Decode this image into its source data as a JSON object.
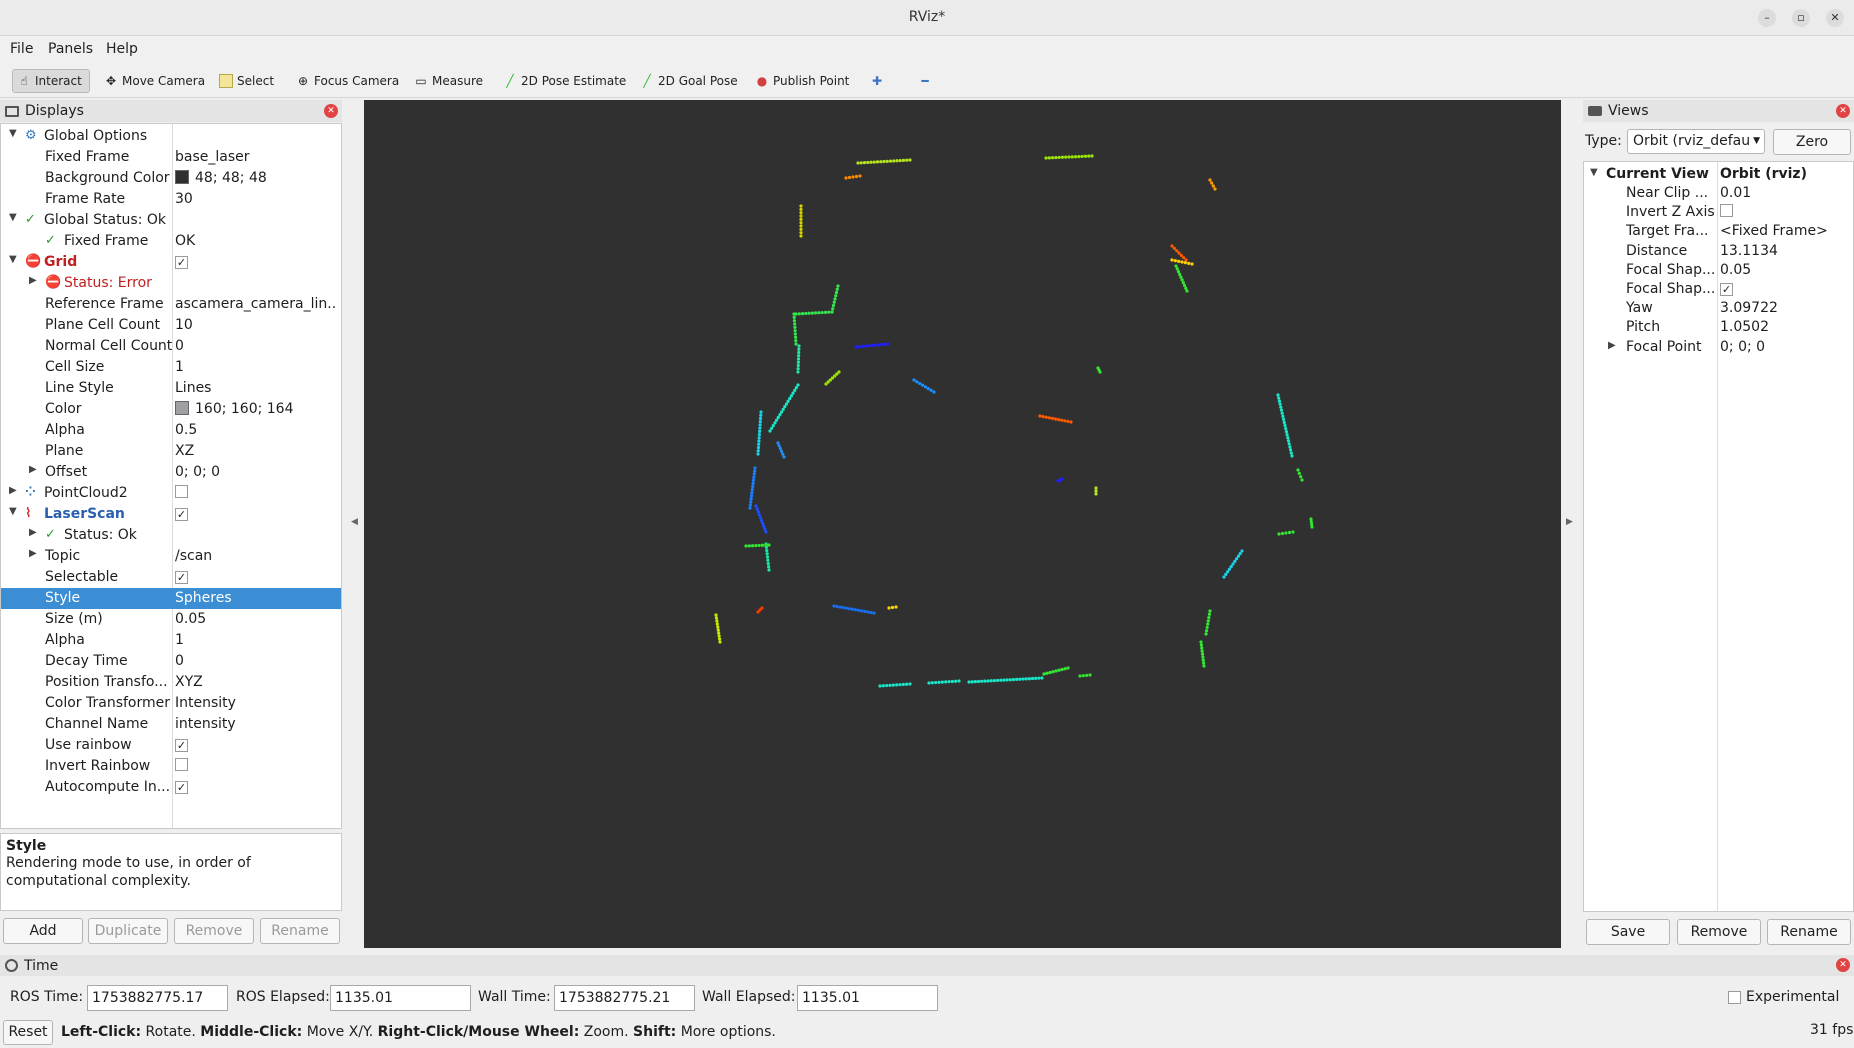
{
  "window": {
    "title": "RViz*"
  },
  "menu": [
    "File",
    "Panels",
    "Help"
  ],
  "toolbar": {
    "tools": [
      {
        "label": "Interact",
        "icon": "cursor-icon",
        "active": true
      },
      {
        "label": "Move Camera",
        "icon": "move-camera-icon"
      },
      {
        "label": "Select",
        "icon": "select-icon"
      },
      {
        "label": "Focus Camera",
        "icon": "focus-camera-icon"
      },
      {
        "label": "Measure",
        "icon": "ruler-icon"
      },
      {
        "label": "2D Pose Estimate",
        "icon": "pose-arrow-icon"
      },
      {
        "label": "2D Goal Pose",
        "icon": "goal-arrow-icon"
      },
      {
        "label": "Publish Point",
        "icon": "map-pin-icon"
      }
    ]
  },
  "displays": {
    "title": "Displays",
    "rows": [
      {
        "label": "Global Options",
        "value": "",
        "indent": 1,
        "expand": "down",
        "icon": "gear"
      },
      {
        "label": "Fixed Frame",
        "value": "base_laser",
        "indent": 2
      },
      {
        "label": "Background Color",
        "value": "48; 48; 48",
        "indent": 2,
        "swatch": "#303030"
      },
      {
        "label": "Frame Rate",
        "value": "30",
        "indent": 2
      },
      {
        "label": "Global Status: Ok",
        "value": "",
        "indent": 1,
        "expand": "down",
        "icon": "check"
      },
      {
        "label": "Fixed Frame",
        "value": "OK",
        "indent": 2,
        "icon": "check"
      },
      {
        "label": "Grid",
        "value": "",
        "indent": 1,
        "expand": "down",
        "icon": "error",
        "checkbox": true,
        "style": "error"
      },
      {
        "label": "Status: Error",
        "value": "",
        "indent": 2,
        "expand": "right",
        "icon": "error",
        "style": "errtext"
      },
      {
        "label": "Reference Frame",
        "value": "ascamera_camera_lin...",
        "indent": 2
      },
      {
        "label": "Plane Cell Count",
        "value": "10",
        "indent": 2
      },
      {
        "label": "Normal Cell Count",
        "value": "0",
        "indent": 2
      },
      {
        "label": "Cell Size",
        "value": "1",
        "indent": 2
      },
      {
        "label": "Line Style",
        "value": "Lines",
        "indent": 2
      },
      {
        "label": "Color",
        "value": "160; 160; 164",
        "indent": 2,
        "swatch": "#a0a0a4"
      },
      {
        "label": "Alpha",
        "value": "0.5",
        "indent": 2
      },
      {
        "label": "Plane",
        "value": "XZ",
        "indent": 2
      },
      {
        "label": "Offset",
        "value": "0; 0; 0",
        "indent": 2,
        "expand": "right"
      },
      {
        "label": "PointCloud2",
        "value": "",
        "indent": 1,
        "expand": "right",
        "icon": "cloud",
        "checkbox": false
      },
      {
        "label": "LaserScan",
        "value": "",
        "indent": 1,
        "expand": "down",
        "icon": "laser",
        "checkbox": true,
        "style": "bluebold"
      },
      {
        "label": "Status: Ok",
        "value": "",
        "indent": 2,
        "expand": "right",
        "icon": "check"
      },
      {
        "label": "Topic",
        "value": "/scan",
        "indent": 2,
        "expand": "right"
      },
      {
        "label": "Selectable",
        "value": "",
        "indent": 2,
        "checkbox": true
      },
      {
        "label": "Style",
        "value": "Spheres",
        "indent": 2,
        "selected": true
      },
      {
        "label": "Size (m)",
        "value": "0.05",
        "indent": 2
      },
      {
        "label": "Alpha",
        "value": "1",
        "indent": 2
      },
      {
        "label": "Decay Time",
        "value": "0",
        "indent": 2
      },
      {
        "label": "Position Transfo...",
        "value": "XYZ",
        "indent": 2
      },
      {
        "label": "Color Transformer",
        "value": "Intensity",
        "indent": 2
      },
      {
        "label": "Channel Name",
        "value": "intensity",
        "indent": 2
      },
      {
        "label": "Use rainbow",
        "value": "",
        "indent": 2,
        "checkbox": true
      },
      {
        "label": "Invert Rainbow",
        "value": "",
        "indent": 2,
        "checkbox": false
      },
      {
        "label": "Autocompute In...",
        "value": "",
        "indent": 2,
        "checkbox": true
      }
    ],
    "help_title": "Style",
    "help_text": "Rendering mode to use, in order of computational complexity.",
    "buttons": {
      "add": "Add",
      "duplicate": "Duplicate",
      "remove": "Remove",
      "rename": "Rename"
    }
  },
  "views": {
    "title": "Views",
    "type_label": "Type:",
    "type_value": "Orbit (rviz_defau",
    "zero": "Zero",
    "header_label": "Current View",
    "header_value": "Orbit (rviz)",
    "rows": [
      {
        "label": "Near Clip ...",
        "value": "0.01"
      },
      {
        "label": "Invert Z Axis",
        "value": "",
        "checkbox": false
      },
      {
        "label": "Target Fra...",
        "value": "<Fixed Frame>"
      },
      {
        "label": "Distance",
        "value": "13.1134"
      },
      {
        "label": "Focal Shap...",
        "value": "0.05"
      },
      {
        "label": "Focal Shap...",
        "value": "",
        "checkbox": true
      },
      {
        "label": "Yaw",
        "value": "3.09722"
      },
      {
        "label": "Pitch",
        "value": "1.0502"
      },
      {
        "label": "Focal Point",
        "value": "0; 0; 0",
        "expand": "right"
      }
    ],
    "buttons": {
      "save": "Save",
      "remove": "Remove",
      "rename": "Rename"
    }
  },
  "time": {
    "title": "Time",
    "ros_time_label": "ROS Time:",
    "ros_time": "1753882775.17",
    "ros_elapsed_label": "ROS Elapsed:",
    "ros_elapsed": "1135.01",
    "wall_time_label": "Wall Time:",
    "wall_time": "1753882775.21",
    "wall_elapsed_label": "Wall Elapsed:",
    "wall_elapsed": "1135.01",
    "experimental": "Experimental"
  },
  "statusbar": {
    "reset": "Reset",
    "hints": [
      {
        "key": "Left-Click:",
        "text": " Rotate. "
      },
      {
        "key": "Middle-Click:",
        "text": " Move X/Y. "
      },
      {
        "key": "Right-Click/Mouse Wheel:",
        "text": " Zoom. "
      },
      {
        "key": "Shift:",
        "text": " More options."
      }
    ],
    "fps": "31 fps"
  },
  "viewport": {
    "background": "#303030"
  }
}
